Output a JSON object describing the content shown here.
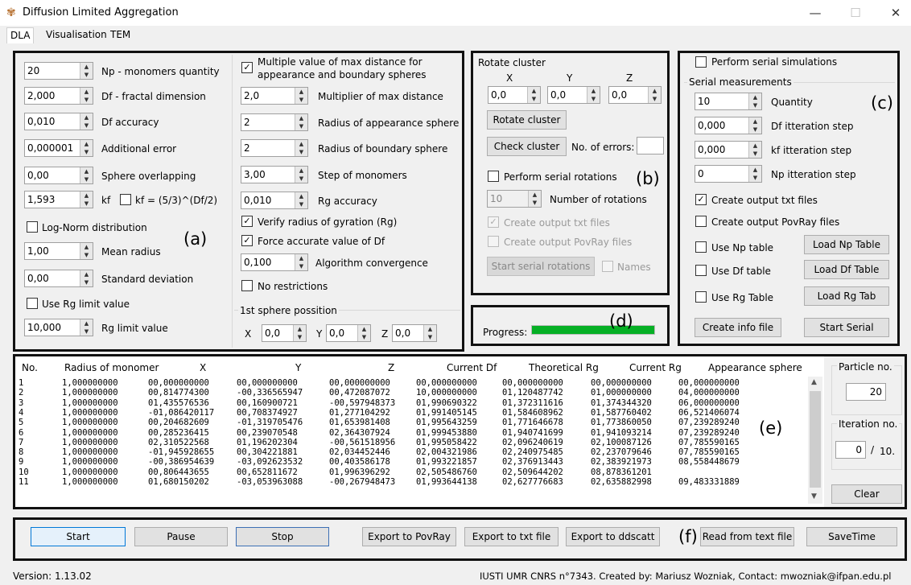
{
  "window": {
    "title": "Diffusion Limited Aggregation",
    "min": "—",
    "max": "☐",
    "close": "✕"
  },
  "tabs": [
    "DLA",
    "Visualisation",
    "TEM"
  ],
  "panel_a": {
    "np": {
      "value": "20",
      "label": "Np - monomers quantity"
    },
    "df": {
      "value": "2,000",
      "label": "Df - fractal dimension"
    },
    "df_acc": {
      "value": "0,010",
      "label": "Df accuracy"
    },
    "add_err": {
      "value": "0,000001",
      "label": "Additional error"
    },
    "overlap": {
      "value": "0,00",
      "label": "Sphere overlapping"
    },
    "kf": {
      "value": "1,593",
      "label": "kf",
      "formula": "kf = (5/3)^(Df/2)"
    },
    "lognorm": "Log-Norm distribution",
    "mean_r": {
      "value": "1,00",
      "label": "Mean radius"
    },
    "std": {
      "value": "0,00",
      "label": "Standard deviation"
    },
    "use_rg": "Use Rg limit value",
    "rg_lim": {
      "value": "10,000",
      "label": "Rg limit value"
    },
    "tag": "(a)"
  },
  "panel_mid": {
    "multi": "Multiple value of max distance for",
    "multi2": "appearance and boundary spheres",
    "mult": {
      "value": "2,0",
      "label": "Multiplier of max distance"
    },
    "r_app": {
      "value": "2",
      "label": "Radius of appearance sphere"
    },
    "r_bnd": {
      "value": "2",
      "label": "Radius of boundary sphere"
    },
    "step": {
      "value": "3,00",
      "label": "Step of monomers"
    },
    "rg_acc": {
      "value": "0,010",
      "label": "Rg accuracy"
    },
    "verify": "Verify radius of gyration (Rg)",
    "force": "Force accurate value of Df",
    "alg": {
      "value": "0,100",
      "label": "Algorithm convergence"
    },
    "norestr": "No restrictions",
    "first": "1st sphere possition",
    "x": "X",
    "xv": "0,0",
    "y": "Y",
    "yv": "0,0",
    "z": "Z",
    "zv": "0,0"
  },
  "panel_b": {
    "title": "Rotate cluster",
    "x": "X",
    "y": "Y",
    "z": "Z",
    "xv": "0,0",
    "yv": "0,0",
    "zv": "0,0",
    "rotate": "Rotate cluster",
    "check": "Check cluster",
    "errors": "No. of errors:",
    "serial": "Perform serial rotations",
    "nrot": {
      "value": "10",
      "label": "Number of rotations"
    },
    "txt": "Create output txt files",
    "pov": "Create output PovRay files",
    "start": "Start serial rotations",
    "names": "Names",
    "tag": "(b)"
  },
  "panel_c": {
    "perform": "Perform serial simulations",
    "meas": "Serial measurements",
    "qty": {
      "value": "10",
      "label": "Quantity"
    },
    "dfstep": {
      "value": "0,000",
      "label": "Df itteration step"
    },
    "kfstep": {
      "value": "0,000",
      "label": "kf itteration step"
    },
    "npstep": {
      "value": "0",
      "label": "Np itteration step"
    },
    "txt": "Create output txt files",
    "pov": "Create output PovRay files",
    "usenp": "Use Np table",
    "usedf": "Use Df table",
    "userg": "Use Rg Table",
    "loadnp": "Load Np Table",
    "loaddf": "Load Df Table",
    "loadrg": "Load Rg Tab",
    "info": "Create info file",
    "start": "Start Serial",
    "tag": "(c)"
  },
  "panel_d": {
    "label": "Progress:",
    "tag": "(d)",
    "progress": 1.0,
    "color": "#06b025"
  },
  "panel_e": {
    "headers": [
      "No.",
      "Radius of monomer",
      "X",
      "Y",
      "Z",
      "Current Df",
      "Theoretical Rg",
      "Current Rg",
      "Appearance sphere"
    ],
    "rows": [
      [
        "1",
        "1,000000000",
        "00,000000000",
        "00,000000000",
        "00,000000000",
        "00,000000000",
        "00,000000000",
        "00,000000000",
        "00,000000000"
      ],
      [
        "2",
        "1,000000000",
        "00,814774300",
        "-00,336565947",
        "00,472087072",
        "10,000000000",
        "01,120487742",
        "01,000000000",
        "04,000000000"
      ],
      [
        "3",
        "1,000000000",
        "01,435576536",
        "00,160900721",
        "-00,597948373",
        "01,990690322",
        "01,372311616",
        "01,374344320",
        "06,000000000"
      ],
      [
        "4",
        "1,000000000",
        "-01,086420117",
        "00,708374927",
        "01,277104292",
        "01,991405145",
        "01,584608962",
        "01,587760402",
        "06,521406074"
      ],
      [
        "5",
        "1,000000000",
        "00,204682609",
        "-01,319705476",
        "01,653981408",
        "01,995643259",
        "01,771646678",
        "01,773860050",
        "07,239289240"
      ],
      [
        "6",
        "1,000000000",
        "00,285236415",
        "00,239070548",
        "02,364307924",
        "01,999453880",
        "01,940741699",
        "01,941093214",
        "07,239289240"
      ],
      [
        "7",
        "1,000000000",
        "02,310522568",
        "01,196202304",
        "-00,561518956",
        "01,995058422",
        "02,096240619",
        "02,100087126",
        "07,785590165"
      ],
      [
        "8",
        "1,000000000",
        "-01,945928655",
        "00,304221881",
        "02,034452446",
        "02,004321986",
        "02,240975485",
        "02,237079646",
        "07,785590165"
      ],
      [
        "9",
        "1,000000000",
        "-00,386954639",
        "-03,092623532",
        "00,403586178",
        "01,993221857",
        "02,376913443",
        "02,383921973",
        "08,558448679"
      ],
      [
        "10",
        "1,000000000",
        "00,806443655",
        "00,652811672",
        "01,996396292",
        "02,505486760",
        "02,509644202",
        "08,878361201",
        ""
      ],
      [
        "11",
        "1,000000000",
        "01,680150202",
        "-03,053963088",
        "-00,267948473",
        "01,993644138",
        "02,627776683",
        "02,635882998",
        "09,483331889"
      ]
    ],
    "particle_label": "Particle no.",
    "particle": "20",
    "iter_label": "Iteration no.",
    "iter": "0",
    "iter_sep": "/",
    "iter_max": "10.",
    "clear": "Clear",
    "tag": "(e)"
  },
  "panel_f": {
    "start": "Start",
    "pause": "Pause",
    "stop": "Stop",
    "pov": "Export to PovRay",
    "txt": "Export to txt file",
    "dds": "Export to ddscatt",
    "read": "Read from text file",
    "save": "SaveTime",
    "tag": "(f)"
  },
  "status": {
    "version": "Version: 1.13.02",
    "credit": "IUSTI UMR CNRS n°7343. Created by: Mariusz Wozniak, Contact: mwozniak@ifpan.edu.pl"
  }
}
